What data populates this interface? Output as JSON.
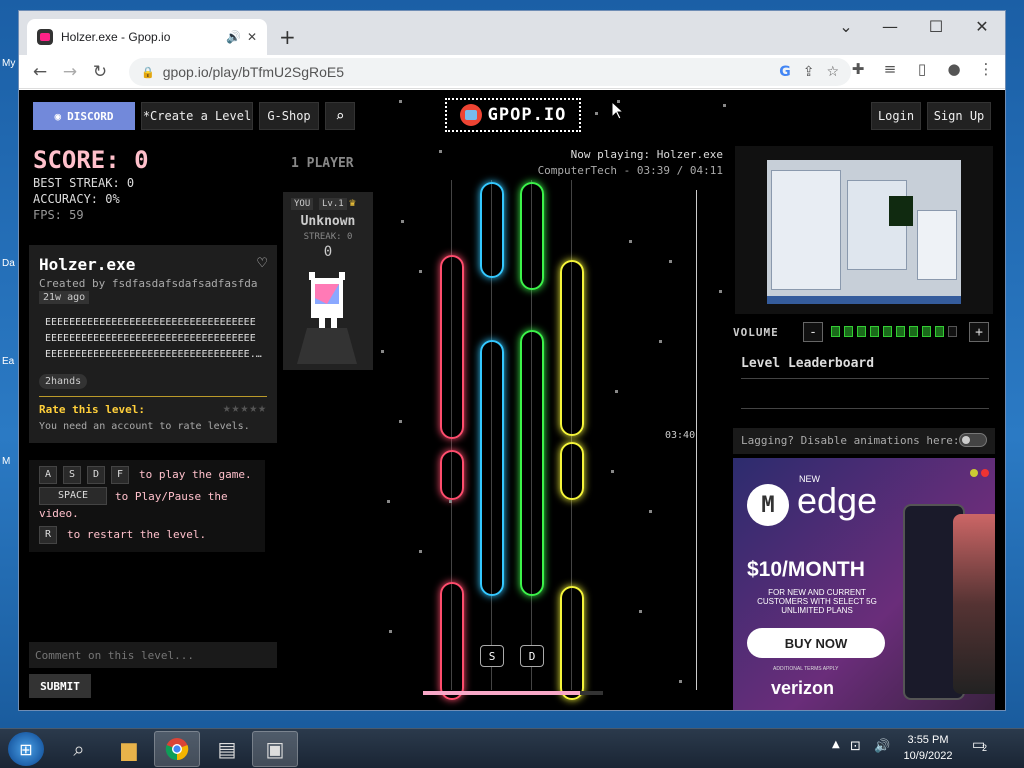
{
  "desktop": {
    "icon_labels": [
      "My",
      "Da",
      "Ea",
      "M"
    ]
  },
  "browser": {
    "tab_title": "Holzer.exe - Gpop.io",
    "new_tab": "+",
    "url": "gpop.io/play/bTfmU2SgRoE5",
    "window_controls": {
      "minimize": "—",
      "maximize": "☐",
      "close": "✕",
      "dropdown": "⌄"
    }
  },
  "header": {
    "discord_label": "DISCORD",
    "create_label": "*Create a Level",
    "shop_label": "G-Shop",
    "logo_text": "GPOP.IO",
    "login_label": "Login",
    "signup_label": "Sign Up"
  },
  "stats": {
    "score": "SCORE: 0",
    "best_streak": "BEST STREAK: 0",
    "accuracy": "ACCURACY: 0%",
    "fps": "FPS: 59"
  },
  "song": {
    "title": "Holzer.exe",
    "creator": "Created by fsdfasdafsdafsadfasfda",
    "ago": "21w ago",
    "lyrics": [
      "EEEEEEEEEEEEEEEEEEEEEEEEEEEEEEEEEEE",
      "EEEEEEEEEEEEEEEEEEEEEEEEEEEEEEEEEEE",
      "EEEEEEEEEEEEEEEEEEEEEEEEEEEEEEEEEE..."
    ],
    "tag": "2hands",
    "rate_label": "Rate this level:",
    "stars": "★★★★★",
    "account_note": "You need an account to rate levels."
  },
  "controls": {
    "keys": [
      "A",
      "S",
      "D",
      "F"
    ],
    "play_text": "to play the game.",
    "space_key": "SPACE",
    "pause_text_1": "to Play/Pause the",
    "pause_text_2": "video.",
    "restart_key": "R",
    "restart_text": "to restart the level."
  },
  "comment": {
    "placeholder": "Comment on this level...",
    "submit": "SUBMIT"
  },
  "player": {
    "heading": "1 PLAYER",
    "you": "YOU",
    "level": "Lv.1",
    "name": "Unknown",
    "streak": "STREAK: 0",
    "score": "0"
  },
  "now_playing": {
    "label": "Now playing: Holzer.exe",
    "detail": "ComputerTech - 03:39 / 04:11"
  },
  "track": {
    "time_marker": "03:40",
    "lane_keys": [
      "S",
      "D"
    ],
    "progress": 0.87,
    "colors": {
      "A": "#ff4d6d",
      "S": "#34c8ff",
      "D": "#3cf24a",
      "F": "#f5f53a"
    }
  },
  "sidebar": {
    "volume_label": "VOLUME",
    "volume_minus": "-",
    "volume_plus": "+",
    "volume_level": 9,
    "volume_segments": 10,
    "leaderboard_title": "Level Leaderboard",
    "lagging_text": "Lagging? Disable animations here:"
  },
  "ad": {
    "new": "NEW",
    "brand_mark": "M",
    "product": "edge",
    "price": "$10/MONTH",
    "subtext": "FOR NEW AND CURRENT CUSTOMERS WITH SELECT 5G UNLIMITED PLANS",
    "cta": "BUY NOW",
    "fine_print": "ADDITIONAL TERMS APPLY",
    "carrier": "verizon"
  },
  "taskbar": {
    "time": "3:55 PM",
    "date": "10/9/2022",
    "notifications": "2"
  }
}
